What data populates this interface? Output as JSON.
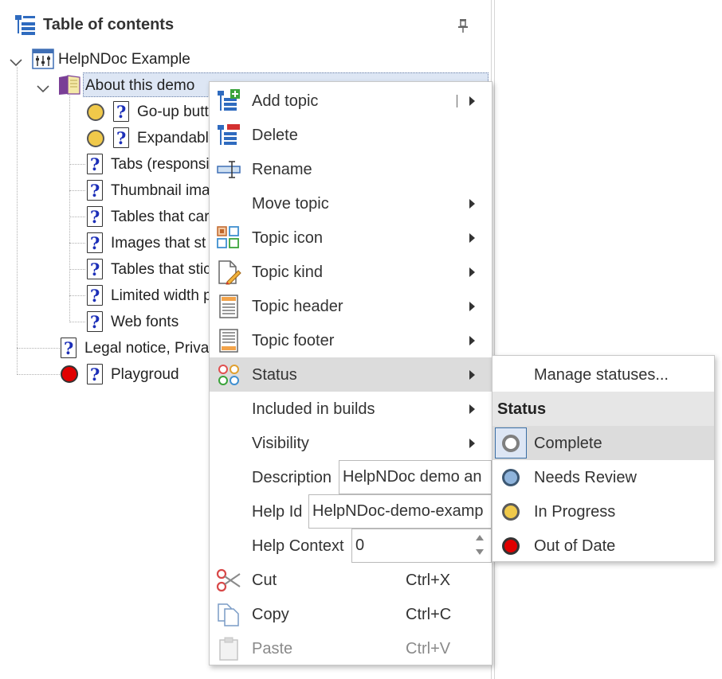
{
  "panel": {
    "title": "Table of contents"
  },
  "tree": {
    "root": "HelpNDoc Example",
    "about": "About this demo",
    "children": [
      "Go-up butt",
      "Expandabl",
      "Tabs (responsi",
      "Thumbnail ima",
      "Tables that car",
      "Images that st",
      "Tables that stic",
      "Limited width p",
      "Web fonts"
    ],
    "legal": "Legal notice, Privac",
    "playground": "Playgroud"
  },
  "menu": {
    "add_topic": "Add topic",
    "delete": "Delete",
    "rename": "Rename",
    "move_topic": "Move topic",
    "topic_icon": "Topic icon",
    "topic_kind": "Topic kind",
    "topic_header": "Topic header",
    "topic_footer": "Topic footer",
    "status": "Status",
    "included_in_builds": "Included in builds",
    "visibility": "Visibility",
    "description_label": "Description",
    "description_value": "HelpNDoc demo an",
    "help_id_label": "Help Id",
    "help_id_value": "HelpNDoc-demo-examp",
    "help_context_label": "Help Context",
    "help_context_value": "0",
    "cut": "Cut",
    "cut_shortcut": "Ctrl+X",
    "copy": "Copy",
    "copy_shortcut": "Ctrl+C",
    "paste": "Paste",
    "paste_shortcut": "Ctrl+V"
  },
  "submenu": {
    "manage": "Manage statuses...",
    "header": "Status",
    "items": [
      {
        "label": "Complete",
        "color": "#ffffff"
      },
      {
        "label": "Needs Review",
        "color": "#8fb4dc"
      },
      {
        "label": "In Progress",
        "color": "#f0c94a"
      },
      {
        "label": "Out of Date",
        "color": "#e00000"
      }
    ]
  },
  "colors": {
    "status_yellow": "#f0c94a",
    "status_red": "#e00000",
    "selection": "#dde6f4",
    "menu_hover": "#dcdcdc"
  }
}
